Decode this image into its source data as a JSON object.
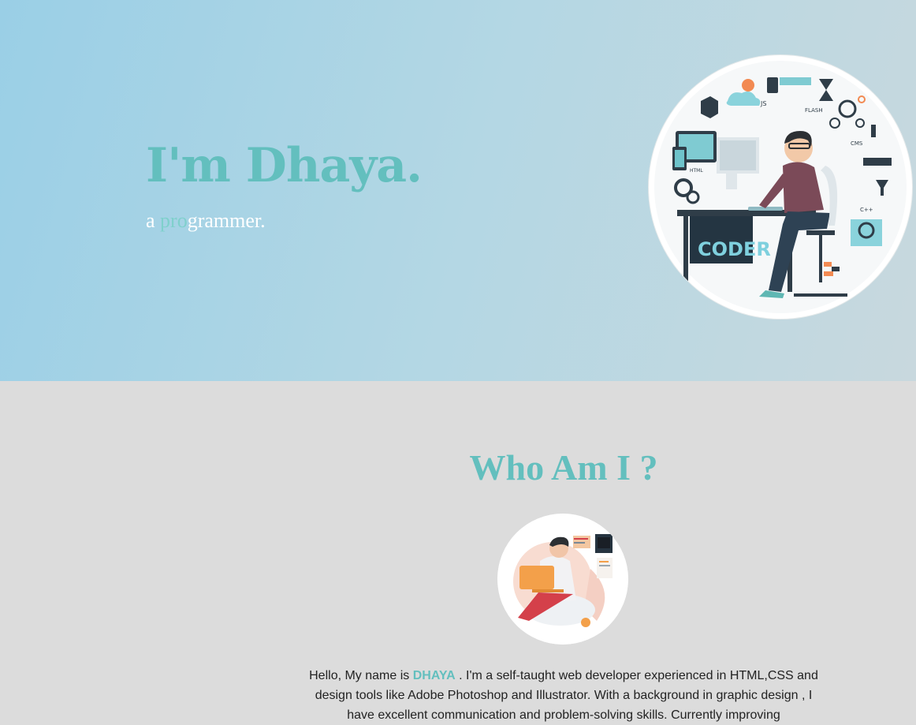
{
  "hero": {
    "title": "I'm Dhaya.",
    "subtitle_prefix": "a ",
    "subtitle_accent": "pro",
    "subtitle_rest": "grammer.",
    "illustration_labels": {
      "coder": "CODER",
      "js": "JS",
      "flash": "FLASH",
      "cms": "CMS",
      "html": "HTML",
      "cpp": "C++"
    }
  },
  "about": {
    "title": "Who Am I ?",
    "text_before": "Hello, My name is ",
    "name": "DHAYA",
    "text_after": " . I'm a self-taught web developer experienced in HTML,CSS and design tools like Adobe Photoshop and Illustrator. With a background in graphic design , I have excellent communication and problem-solving skills. Currently improving"
  },
  "colors": {
    "accent": "#63bfbe",
    "hero_gradient_start": "#9acfe6",
    "hero_gradient_end": "#c8d8de",
    "about_bg": "#dcdcdc"
  }
}
